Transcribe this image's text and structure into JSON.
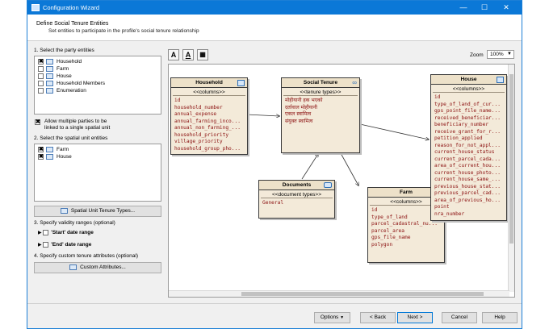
{
  "window": {
    "title": "Configuration Wizard",
    "minimize": "—",
    "maximize": "☐",
    "close": "✕"
  },
  "header": {
    "title": "Define Social Tenure Entities",
    "subtitle": "Set entities to participate in the profile's social tenure relationship"
  },
  "party": {
    "label": "1. Select the party entities",
    "items": [
      {
        "label": "Household",
        "checked": "✖"
      },
      {
        "label": "Farm",
        "checked": ""
      },
      {
        "label": "House",
        "checked": ""
      },
      {
        "label": "Household Members",
        "checked": ""
      },
      {
        "label": "Enumeration",
        "checked": ""
      }
    ]
  },
  "allow_multiple": {
    "checked": "✖",
    "line1": "Allow multiple parties to be",
    "line2": "linked to a single spatial unit"
  },
  "spatial": {
    "label": "2. Select the spatial unit entities",
    "items": [
      {
        "label": "Farm",
        "checked": "✖"
      },
      {
        "label": "House",
        "checked": "✖"
      }
    ],
    "button": "Spatial Unit Tenure Types..."
  },
  "validity": {
    "label": "3. Specify validity ranges (optional)",
    "start": "'Start' date range",
    "end": "'End' date range"
  },
  "custom": {
    "label": "4. Specify custom tenure attributes (optional)",
    "button": "Custom Attributes..."
  },
  "toolbar": {
    "zoom_label": "Zoom",
    "zoom_value": "100%",
    "t1": "A",
    "t2": "A",
    "t3": "▦"
  },
  "entities": {
    "household": {
      "title": "Household",
      "section": "<<columns>>",
      "fields": [
        "id",
        "household_number",
        "annual_expense",
        "annual_farming_inco...",
        "annual_non_farming_...",
        "household_priority",
        "village_priority",
        "household_group_pho..."
      ]
    },
    "social": {
      "title": "Social Tenure",
      "section": "<<tenure types>>",
      "fields": [
        "मोहीयानी हक भएको",
        "दर्तावाल मोहीयानी",
        "एकल स्वामित्व",
        "संयुक्त स्वामित्व"
      ]
    },
    "documents": {
      "title": "Documents",
      "section": "<<document types>>",
      "fields": [
        "General"
      ]
    },
    "farm": {
      "title": "Farm",
      "section": "<<columns>>",
      "fields": [
        "id",
        "type_of_land",
        "parcel_cadastral_nu...",
        "parcel_area",
        "gps_file_name",
        "polygon"
      ]
    },
    "house": {
      "title": "House",
      "section": "<<columns>>",
      "fields": [
        "id",
        "type_of_land_of_cur...",
        "gps_point_file_name...",
        "received_beneficiar...",
        "beneficiary_number",
        "receive_grant_for_r...",
        "petition_applied",
        "reason_for_not_appl...",
        "current_house_status",
        "current_parcel_cada...",
        "area_of_current_hou...",
        "current_house_photo...",
        "current_house_same_...",
        "previous_house_stat...",
        "previous_parcel_cad...",
        "area_of_previous_ho...",
        "point",
        "nra_number"
      ]
    }
  },
  "footer": {
    "options": "Options",
    "back": "< Back",
    "next": "Next >",
    "cancel": "Cancel",
    "help": "Help"
  }
}
